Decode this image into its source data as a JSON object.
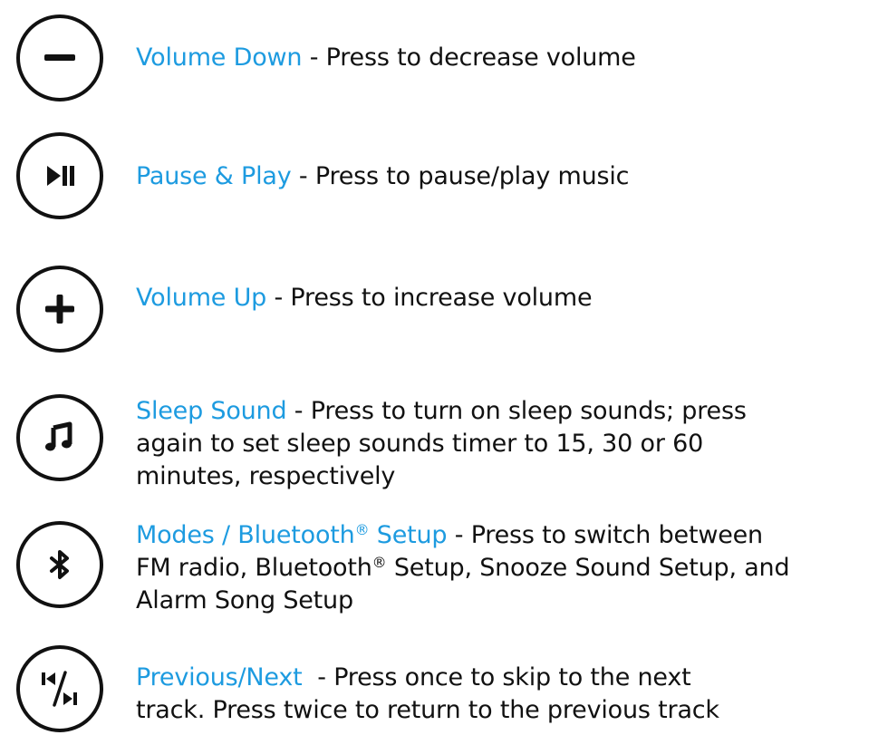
{
  "accent_color": "#1d9be0",
  "text_color": "#111111",
  "items": [
    {
      "icon": "minus-icon",
      "name": "Volume Down",
      "separator": " - ",
      "description": "Press to decrease volume"
    },
    {
      "icon": "play-pause-icon",
      "name": "Pause & Play",
      "separator": " - ",
      "description": "Press to pause/play music"
    },
    {
      "icon": "plus-icon",
      "name": "Volume Up",
      "separator": " - ",
      "description": "Press to increase volume"
    },
    {
      "icon": "music-note-icon",
      "name": "Sleep Sound",
      "separator": " - ",
      "description_lines": [
        "Press to turn on sleep sounds; press",
        "again to set sleep sounds timer to 15, 30 or 60",
        "minutes, respectively"
      ]
    },
    {
      "icon": "bluetooth-icon",
      "name_part1": "Modes / Bluetooth",
      "registered_mark": "®",
      "name_part2": " Setup",
      "separator": " - ",
      "description_line1": "Press to switch between",
      "description_line2_part1": "FM radio, Bluetooth",
      "description_line2_part2": " Setup, Snooze Sound Setup, and",
      "description_line3": "Alarm Song Setup"
    },
    {
      "icon": "previous-next-icon",
      "name": "Previous/Next",
      "separator": "  - ",
      "description_lines": [
        "Press once to skip to the next",
        "track. Press twice to return to the previous track"
      ]
    }
  ]
}
